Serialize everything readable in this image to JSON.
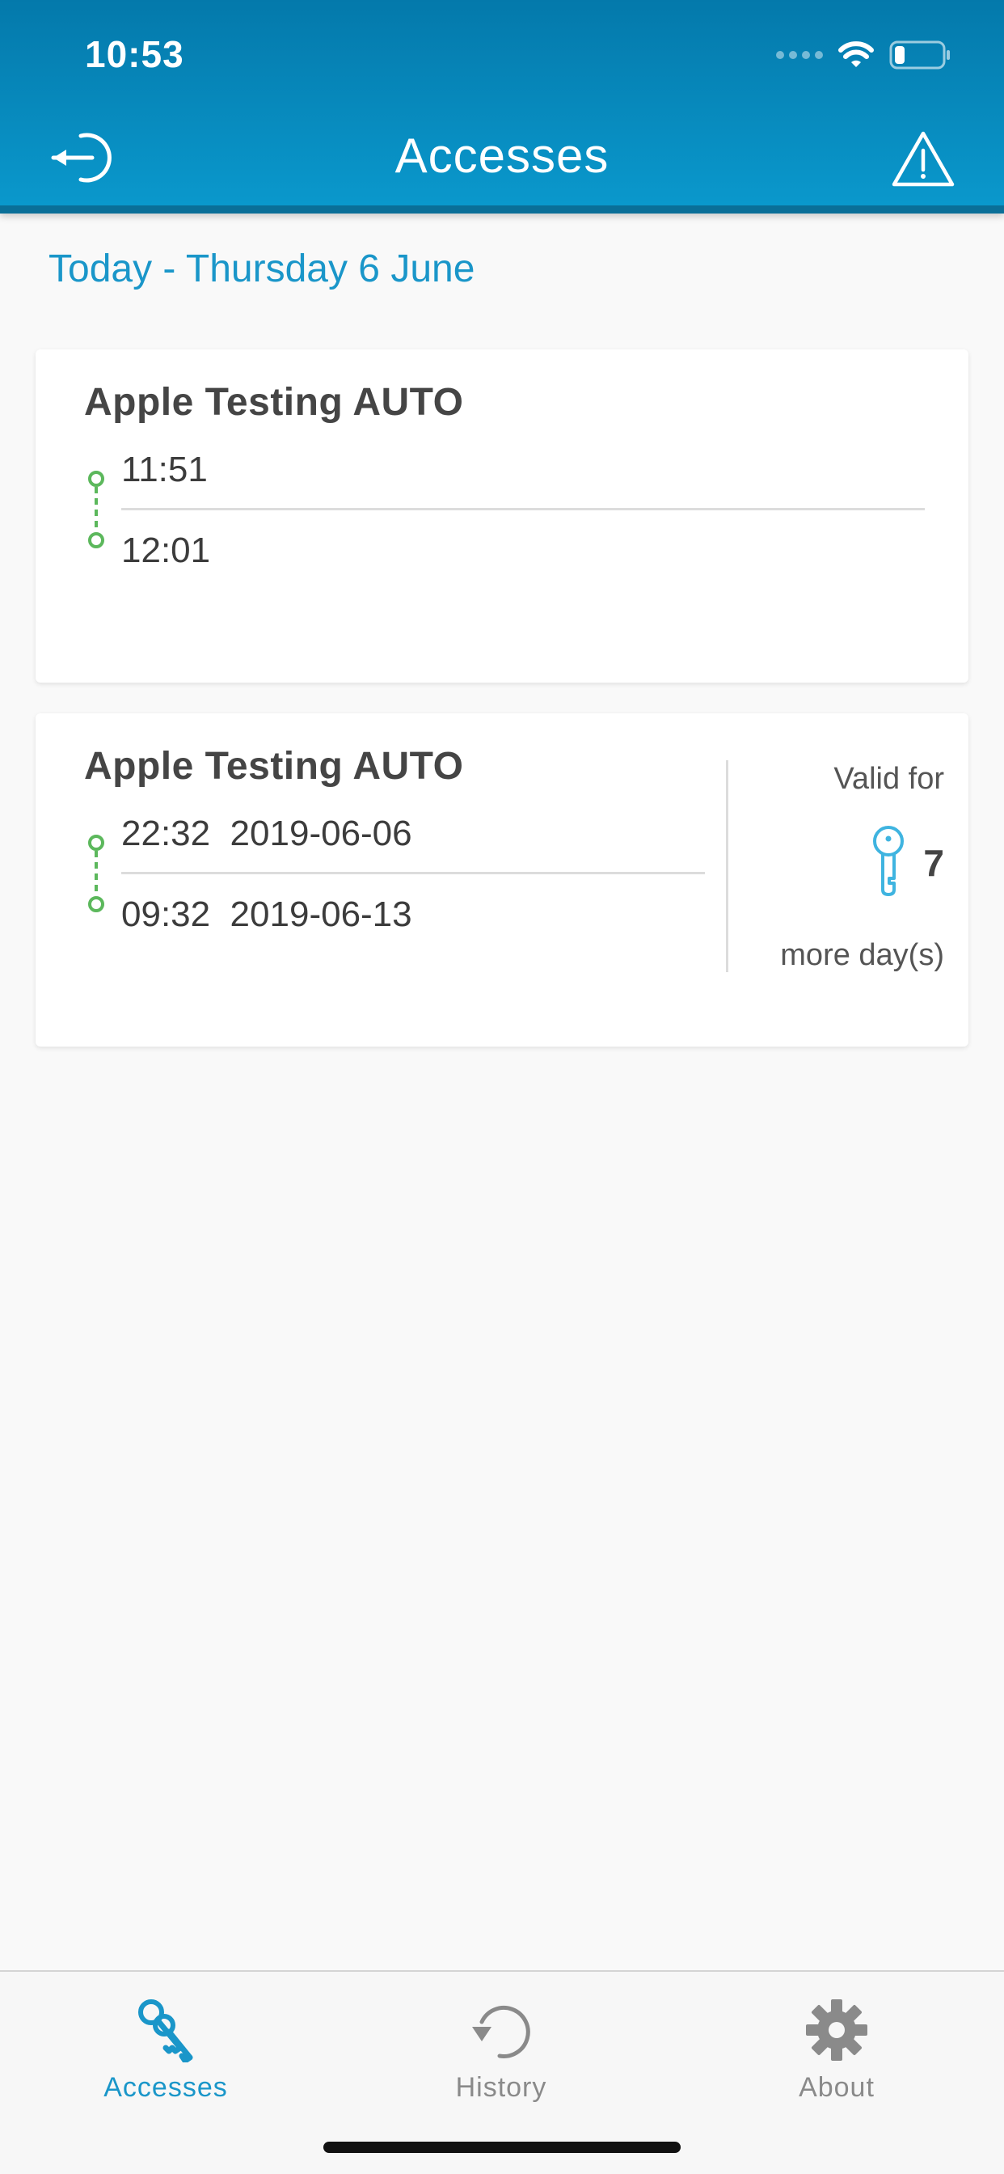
{
  "status_bar": {
    "time": "10:53"
  },
  "header": {
    "title": "Accesses"
  },
  "date_header": "Today - Thursday 6 June",
  "cards": [
    {
      "title": "Apple Testing AUTO",
      "start": "11:51",
      "end": "12:01"
    },
    {
      "title": "Apple Testing AUTO",
      "start": "22:32  2019-06-06",
      "end": "09:32  2019-06-13",
      "valid_for_label": "Valid for",
      "days": "7",
      "more_days_label": "more day(s)"
    }
  ],
  "tabs": [
    {
      "label": "Accesses",
      "icon": "keys-icon",
      "active": true
    },
    {
      "label": "History",
      "icon": "history-icon",
      "active": false
    },
    {
      "label": "About",
      "icon": "gear-icon",
      "active": false
    }
  ],
  "colors": {
    "header": "#0a98cc",
    "accent": "#1a96c9",
    "timeline": "#5cb85c",
    "inactive": "#8a8a8a"
  }
}
